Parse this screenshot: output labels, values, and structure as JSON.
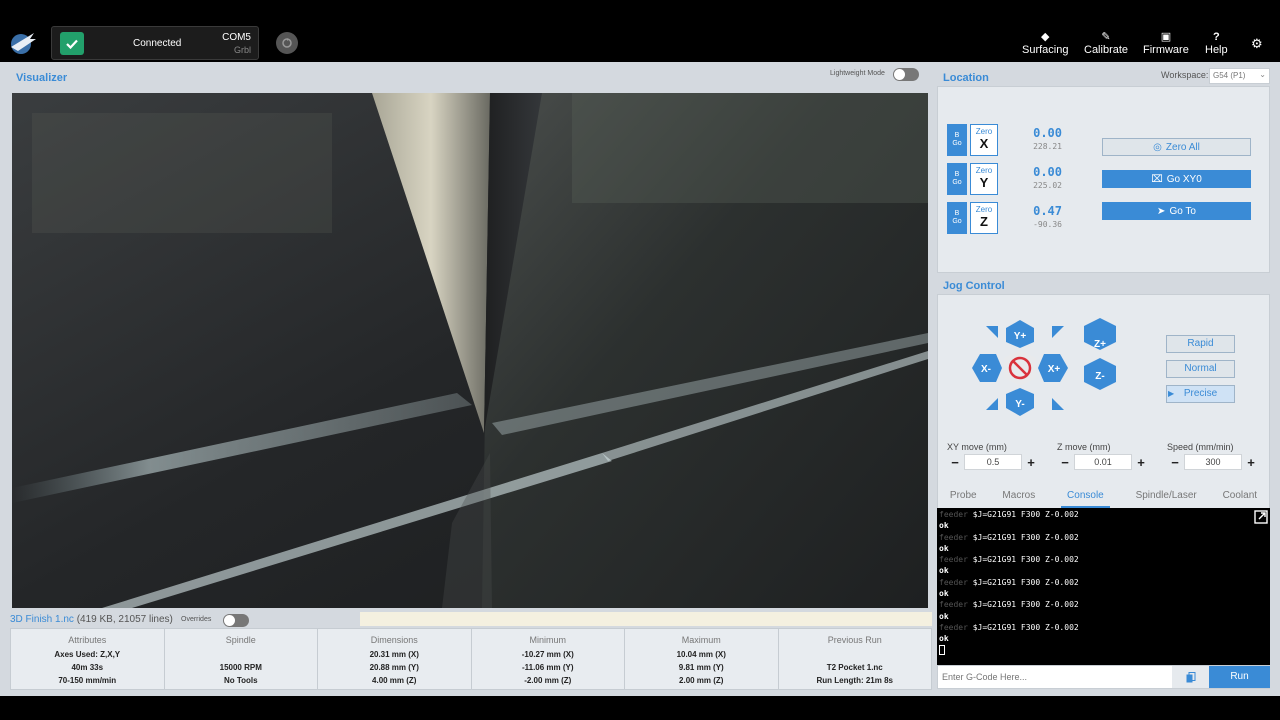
{
  "connection": {
    "status": "Connected",
    "port": "COM5",
    "firmware": "Grbl"
  },
  "topnav": [
    {
      "label": "Surfacing",
      "icon": "surfacing-icon"
    },
    {
      "label": "Calibrate",
      "icon": "calibrate-icon"
    },
    {
      "label": "Firmware",
      "icon": "firmware-icon"
    },
    {
      "label": "Help",
      "icon": "help-icon"
    }
  ],
  "visualizer": {
    "title": "Visualizer",
    "lightweight_label": "Lightweight Mode"
  },
  "file": {
    "name": "3D Finish 1.nc",
    "meta": "(419 KB, 21057 lines)",
    "overrides_label": "Overrides"
  },
  "stats": [
    {
      "header": "Attributes",
      "lines": [
        "Axes Used: Z,X,Y",
        "40m 33s",
        "70-150 mm/min"
      ]
    },
    {
      "header": "Spindle",
      "lines": [
        "",
        "15000 RPM",
        "No Tools"
      ]
    },
    {
      "header": "Dimensions",
      "lines": [
        "20.31 mm (X)",
        "20.88 mm (Y)",
        "4.00 mm (Z)"
      ]
    },
    {
      "header": "Minimum",
      "lines": [
        "-10.27 mm (X)",
        "-11.06 mm (Y)",
        "-2.00 mm (Z)"
      ]
    },
    {
      "header": "Maximum",
      "lines": [
        "10.04 mm (X)",
        "9.81 mm (Y)",
        "2.00 mm (Z)"
      ]
    },
    {
      "header": "Previous Run",
      "lines": [
        "",
        "T2 Pocket 1.nc",
        "Run Length: 21m 8s"
      ]
    }
  ],
  "location": {
    "title": "Location",
    "workspace_label": "Workspace:",
    "workspace_value": "G54 (P1)",
    "go_label": "Go",
    "go_prefix": "B",
    "zero_label": "Zero",
    "axes": [
      {
        "axis": "X",
        "work": "0.00",
        "machine": "228.21"
      },
      {
        "axis": "Y",
        "work": "0.00",
        "machine": "225.02"
      },
      {
        "axis": "Z",
        "work": "0.47",
        "machine": "-90.36"
      }
    ],
    "zero_all": "Zero All",
    "go_xy0": "Go XY0",
    "go_to": "Go  To"
  },
  "jog": {
    "title": "Jog Control",
    "buttons": {
      "yplus": "Y+",
      "yminus": "Y-",
      "xplus": "X+",
      "xminus": "X-",
      "zplus": "Z+",
      "zminus": "Z-"
    },
    "speeds": [
      "Rapid",
      "Normal",
      "Precise"
    ],
    "selected_speed": "Precise",
    "xy_label": "XY move (mm)",
    "xy_value": "0.5",
    "z_label": "Z move (mm)",
    "z_value": "0.01",
    "speed_label": "Speed (mm/min)",
    "speed_value": "300",
    "minus": "−",
    "plus": "+"
  },
  "tabs": [
    "Probe",
    "Macros",
    "Console",
    "Spindle/Laser",
    "Coolant"
  ],
  "active_tab": "Console",
  "console": {
    "source": "feeder",
    "command": "$J=G21G91 F300 Z-0.002",
    "response": "ok",
    "pairs": 6
  },
  "command_input": {
    "placeholder": "Enter G-Code Here...",
    "prompt": ">",
    "run_label": "Run"
  },
  "colors": {
    "accent": "#3a8bd6",
    "success": "#22a06b",
    "topbar": "#000000",
    "panel": "#e6eaee"
  }
}
